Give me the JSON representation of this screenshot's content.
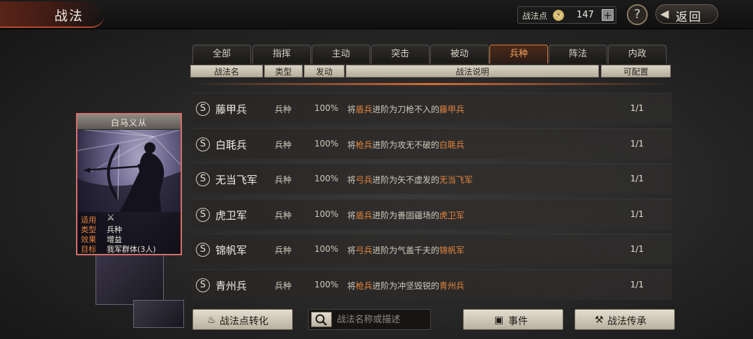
{
  "header": {
    "title": "战法",
    "points_label": "战法点",
    "points_value": "147",
    "plus_label": "+",
    "help_label": "?",
    "back_label": "返回"
  },
  "tabs": [
    {
      "label": "全部",
      "active": false
    },
    {
      "label": "指挥",
      "active": false
    },
    {
      "label": "主动",
      "active": false
    },
    {
      "label": "突击",
      "active": false
    },
    {
      "label": "被动",
      "active": false
    },
    {
      "label": "兵种",
      "active": true
    },
    {
      "label": "阵法",
      "active": false
    },
    {
      "label": "内政",
      "active": false
    }
  ],
  "columns": [
    "战法名",
    "类型",
    "发动",
    "战法说明",
    "可配置"
  ],
  "rows": [
    {
      "grade": "S",
      "name": "藤甲兵",
      "type": "兵种",
      "rate": "100%",
      "desc_pre": "将",
      "desc_unit": "盾兵",
      "desc_mid": "进阶为刀枪不入的",
      "desc_result": "藤甲兵",
      "count": "1/1"
    },
    {
      "grade": "S",
      "name": "白毦兵",
      "type": "兵种",
      "rate": "100%",
      "desc_pre": "将",
      "desc_unit": "枪兵",
      "desc_mid": "进阶为攻无不破的",
      "desc_result": "白毦兵",
      "count": "1/1"
    },
    {
      "grade": "S",
      "name": "无当飞军",
      "type": "兵种",
      "rate": "100%",
      "desc_pre": "将",
      "desc_unit": "弓兵",
      "desc_mid": "进阶为矢不虚发的",
      "desc_result": "无当飞军",
      "count": "1/1"
    },
    {
      "grade": "S",
      "name": "虎卫军",
      "type": "兵种",
      "rate": "100%",
      "desc_pre": "将",
      "desc_unit": "盾兵",
      "desc_mid": "进阶为善固疆场的",
      "desc_result": "虎卫军",
      "count": "1/1"
    },
    {
      "grade": "S",
      "name": "锦帆军",
      "type": "兵种",
      "rate": "100%",
      "desc_pre": "将",
      "desc_unit": "弓兵",
      "desc_mid": "进阶为气盖千夫的",
      "desc_result": "锦帆军",
      "count": "1/1"
    },
    {
      "grade": "S",
      "name": "青州兵",
      "type": "兵种",
      "rate": "100%",
      "desc_pre": "将",
      "desc_unit": "枪兵",
      "desc_mid": "进阶为冲坚毁锐的",
      "desc_result": "青州兵",
      "count": "1/1"
    }
  ],
  "card": {
    "title": "白马义从",
    "info": [
      {
        "label": "适用",
        "value": ""
      },
      {
        "label": "类型",
        "value": "兵种"
      },
      {
        "label": "效果",
        "value": "增益"
      },
      {
        "label": "目标",
        "value": "我军群体(3人)"
      }
    ],
    "applies_icon": "crossed-weapons-icon"
  },
  "bottom": {
    "convert_label": "战法点转化",
    "search_placeholder": "战法名称或描述",
    "event_label": "事件",
    "inherit_label": "战法传承"
  },
  "colors": {
    "accent": "#e6843c",
    "card_border": "#d6706a"
  }
}
